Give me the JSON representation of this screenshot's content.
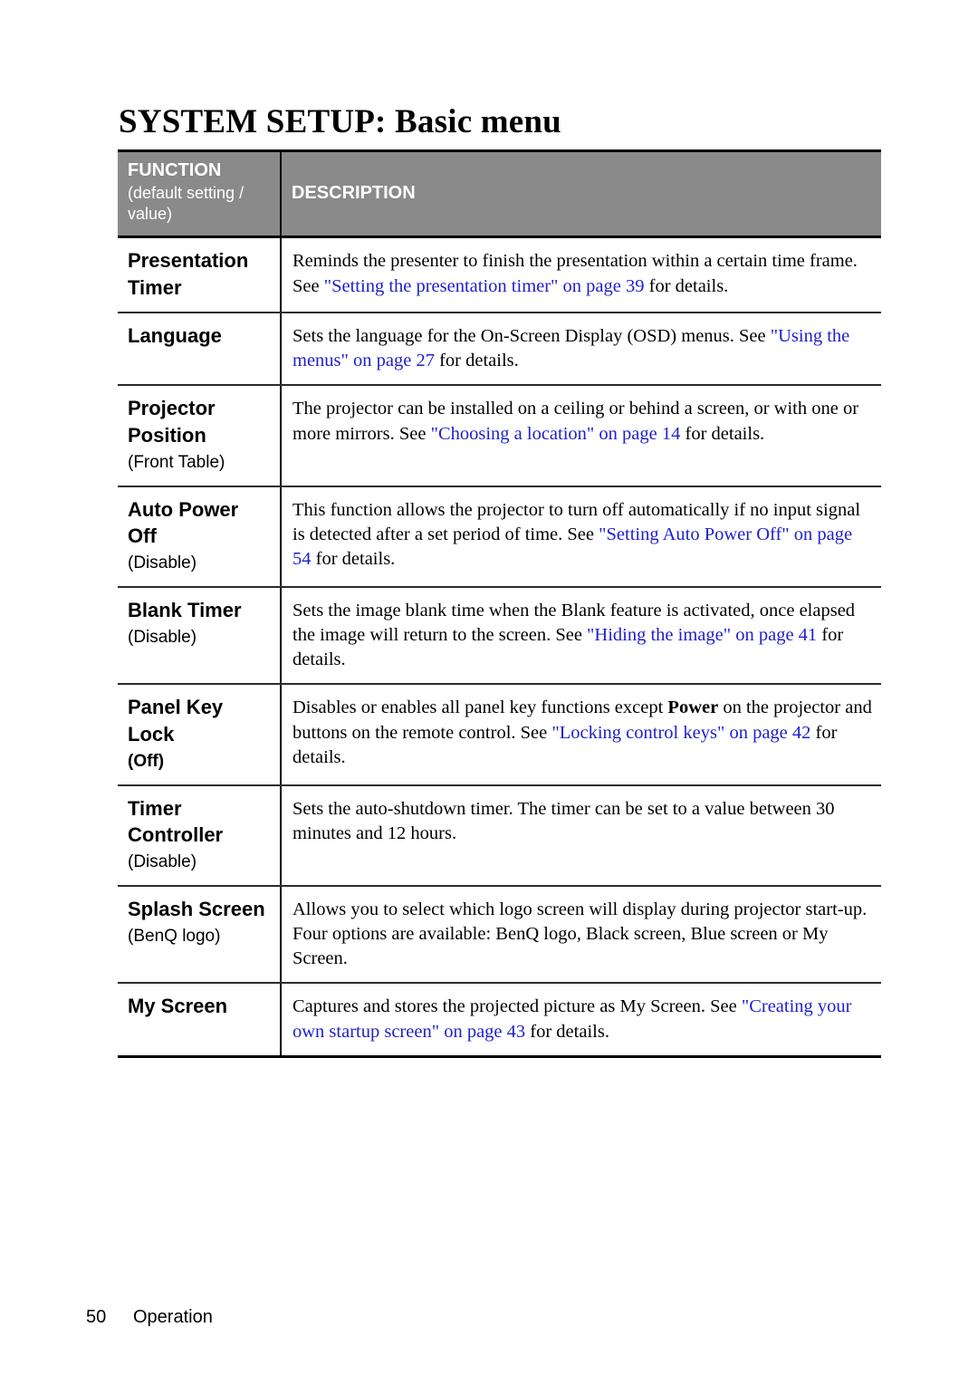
{
  "page": {
    "title": "SYSTEM SETUP: Basic menu",
    "footer_page_number": "50",
    "footer_section": "Operation",
    "link_color": "#2020cc",
    "header_bg": "#8a8a8a"
  },
  "table": {
    "header": {
      "function_label": "FUNCTION",
      "function_sub": "(default setting / value)",
      "description_label": "DESCRIPTION"
    },
    "rows": [
      {
        "function": "Presentation Timer",
        "default": "",
        "description_parts": [
          {
            "text": "Reminds the presenter to finish the presentation within a certain time frame. See ",
            "style": "plain"
          },
          {
            "text": "\"Setting the presentation timer\" on page 39",
            "style": "link"
          },
          {
            "text": " for details.",
            "style": "plain"
          }
        ]
      },
      {
        "function": "Language",
        "default": "",
        "description_parts": [
          {
            "text": "Sets the language for the On-Screen Display (OSD) menus. See ",
            "style": "plain"
          },
          {
            "text": "\"Using the menus\" on page 27",
            "style": "link"
          },
          {
            "text": " for details.",
            "style": "plain"
          }
        ]
      },
      {
        "function": "Projector Position",
        "default": "(Front Table)",
        "description_parts": [
          {
            "text": "The projector can be installed on a ceiling or behind a screen, or with one or more mirrors. See ",
            "style": "plain"
          },
          {
            "text": "\"Choosing a location\" on page 14",
            "style": "link"
          },
          {
            "text": " for details.",
            "style": "plain"
          }
        ]
      },
      {
        "function": "Auto Power Off",
        "default": "(Disable)",
        "description_parts": [
          {
            "text": "This function allows the projector to turn off automatically if no input signal is detected after a set period of time. See ",
            "style": "plain"
          },
          {
            "text": "\"Setting Auto Power Off\" on page 54",
            "style": "link"
          },
          {
            "text": " for details.",
            "style": "plain"
          }
        ]
      },
      {
        "function": "Blank Timer",
        "default": "(Disable)",
        "description_parts": [
          {
            "text": "Sets the image blank time when the Blank feature is activated, once elapsed the image will return to the screen. See ",
            "style": "plain"
          },
          {
            "text": "\"Hiding the image\" on page 41",
            "style": "link"
          },
          {
            "text": " for details.",
            "style": "plain"
          }
        ]
      },
      {
        "function": "Panel Key Lock",
        "default": "(Off)",
        "default_bold": true,
        "description_parts": [
          {
            "text": "Disables or enables all panel key functions except ",
            "style": "plain"
          },
          {
            "text": "Power",
            "style": "bold"
          },
          {
            "text": " on the projector and buttons on the remote control. See ",
            "style": "plain"
          },
          {
            "text": "\"Locking control keys\" on page 42",
            "style": "link"
          },
          {
            "text": " for details.",
            "style": "plain"
          }
        ]
      },
      {
        "function": "Timer Controller",
        "default": "(Disable)",
        "description_parts": [
          {
            "text": "Sets the auto-shutdown timer. The timer can be set to a value between 30 minutes and 12 hours.",
            "style": "plain"
          }
        ]
      },
      {
        "function": "Splash Screen",
        "default": "(BenQ logo)",
        "description_parts": [
          {
            "text": "Allows you to select which logo screen will display during projector start-up. Four options are available: BenQ logo, Black screen, Blue screen or My Screen.",
            "style": "plain"
          }
        ]
      },
      {
        "function": "My Screen",
        "default": "",
        "description_parts": [
          {
            "text": "Captures and stores the projected picture as My Screen. See ",
            "style": "plain"
          },
          {
            "text": "\"Creating your own startup screen\" on page 43",
            "style": "link"
          },
          {
            "text": " for details.",
            "style": "plain"
          }
        ]
      }
    ]
  }
}
